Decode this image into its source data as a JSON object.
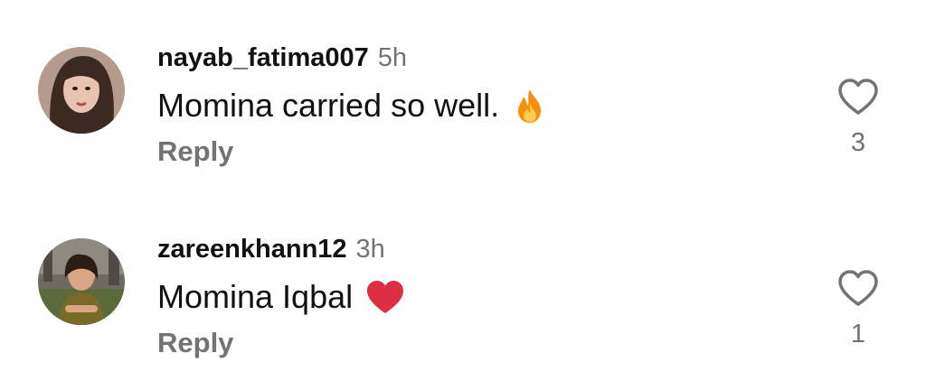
{
  "comments": [
    {
      "username": "nayab_fatima007",
      "time": "5h",
      "text": "Momina carried so well.",
      "emoji": "fire-emoji",
      "reply_label": "Reply",
      "like_count": "3",
      "like_icon": "heart-outline-icon"
    },
    {
      "username": "zareenkhann12",
      "time": "3h",
      "text": "Momina Iqbal",
      "emoji": "red-heart-emoji",
      "reply_label": "Reply",
      "like_count": "1",
      "like_icon": "heart-outline-icon"
    }
  ],
  "colors": {
    "text_primary": "#111111",
    "text_secondary": "#737373",
    "fire_outer": "#f4900c",
    "fire_inner": "#ffcc4d",
    "heart_red": "#dd2e44"
  }
}
